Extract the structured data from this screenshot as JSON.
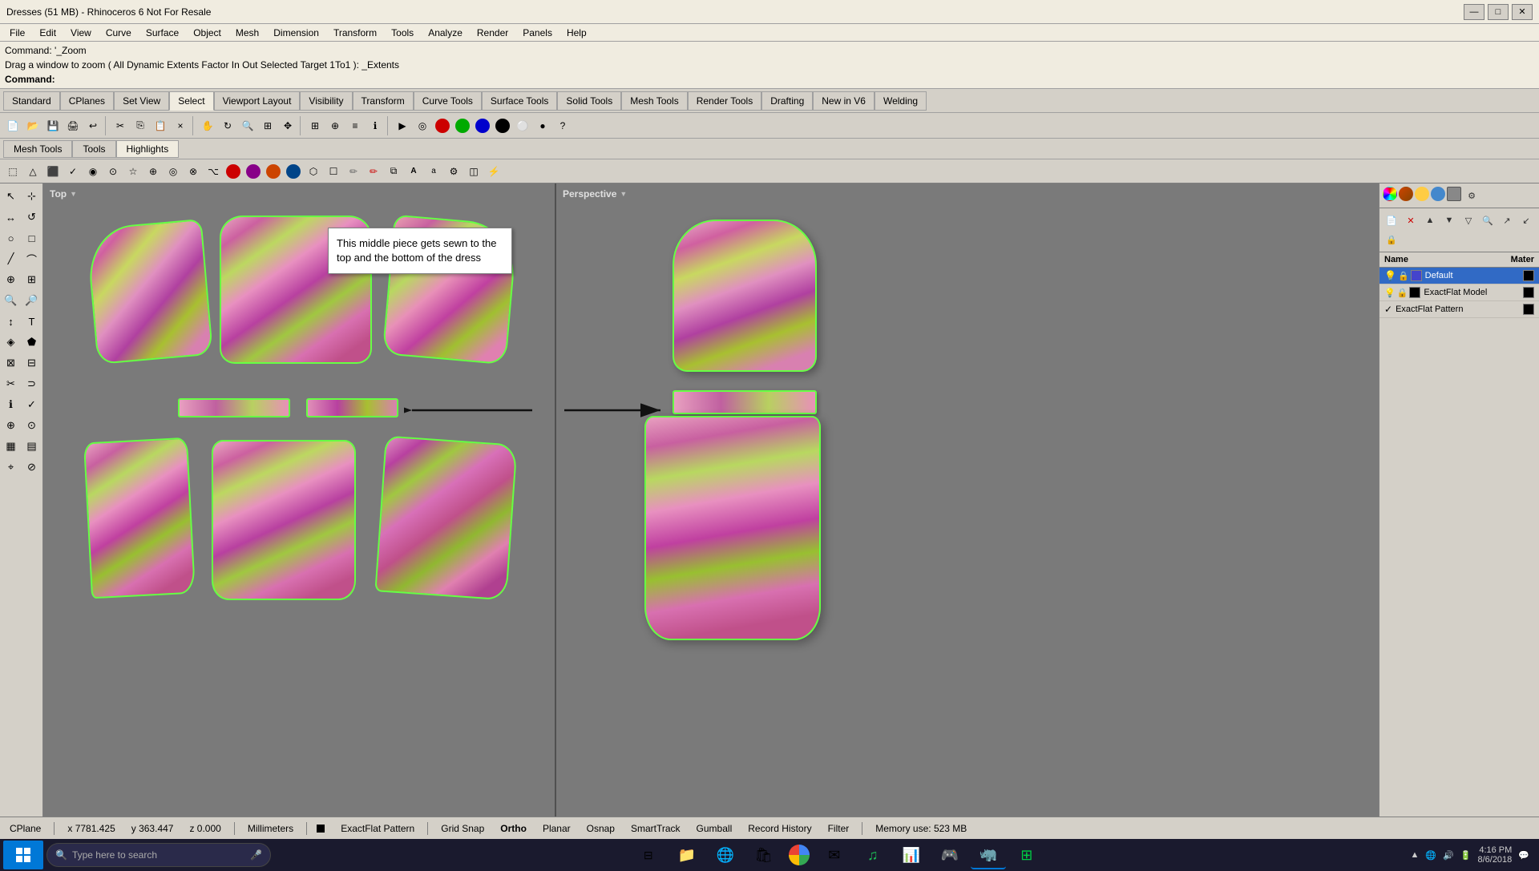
{
  "app": {
    "title": "Dresses (51 MB) - Rhinoceros 6 Not For Resale"
  },
  "win_controls": {
    "minimize": "—",
    "maximize": "□",
    "close": "✕"
  },
  "menu": {
    "items": [
      "File",
      "Edit",
      "View",
      "Curve",
      "Surface",
      "Object",
      "Mesh",
      "Dimension",
      "Transform",
      "Tools",
      "Analyze",
      "Render",
      "Panels",
      "Help"
    ]
  },
  "command": {
    "line1": "Command: '_Zoom",
    "line2": "Drag a window to zoom ( All  Dynamic  Extents  Factor  In  Out  Selected  Target  1To1 ): _Extents",
    "line3": "Command:"
  },
  "toolbar1": {
    "tabs": [
      "Standard",
      "CPlanes",
      "Set View",
      "Select",
      "Viewport Layout",
      "Visibility",
      "Transform",
      "Curve Tools",
      "Surface Tools",
      "Solid Tools",
      "Mesh Tools",
      "Render Tools",
      "Drafting",
      "New in V6",
      "Welding"
    ]
  },
  "subtoolbar": {
    "tabs": [
      "Mesh Tools",
      "Tools",
      "Highlights"
    ]
  },
  "viewports": {
    "top_label": "Top",
    "perspective_label": "Perspective"
  },
  "callout": {
    "text": "This middle piece gets sewn to the top and the bottom of the dress"
  },
  "layers": {
    "header_name": "Name",
    "header_material": "Mater",
    "rows": [
      {
        "name": "Default",
        "selected": true,
        "check": "",
        "swatch_color": "#4444cc"
      },
      {
        "name": "ExactFlat Model",
        "selected": false,
        "check": "",
        "swatch_color": "#000000"
      },
      {
        "name": "ExactFlat Pattern",
        "selected": false,
        "check": "✓",
        "swatch_color": "#000000"
      }
    ]
  },
  "status_bar": {
    "cplane": "CPlane",
    "x": "x 7781.425",
    "y": "y 363.447",
    "z": "z 0.000",
    "units": "Millimeters",
    "layer": "ExactFlat Pattern",
    "grid_snap": "Grid Snap",
    "ortho": "Ortho",
    "planar": "Planar",
    "osnap": "Osnap",
    "smart_track": "SmartTrack",
    "gumball": "Gumball",
    "record_history": "Record History",
    "filter": "Filter",
    "memory": "Memory use: 523 MB"
  },
  "taskbar": {
    "search_placeholder": "Type here to search",
    "apps": [
      "🪟",
      "📁",
      "🌐",
      "🛡",
      "🔵",
      "🎵",
      "📊",
      "🎮",
      "🦊",
      "🖥",
      "📋"
    ],
    "time": "4:16 PM",
    "date": "8/6/2018"
  }
}
